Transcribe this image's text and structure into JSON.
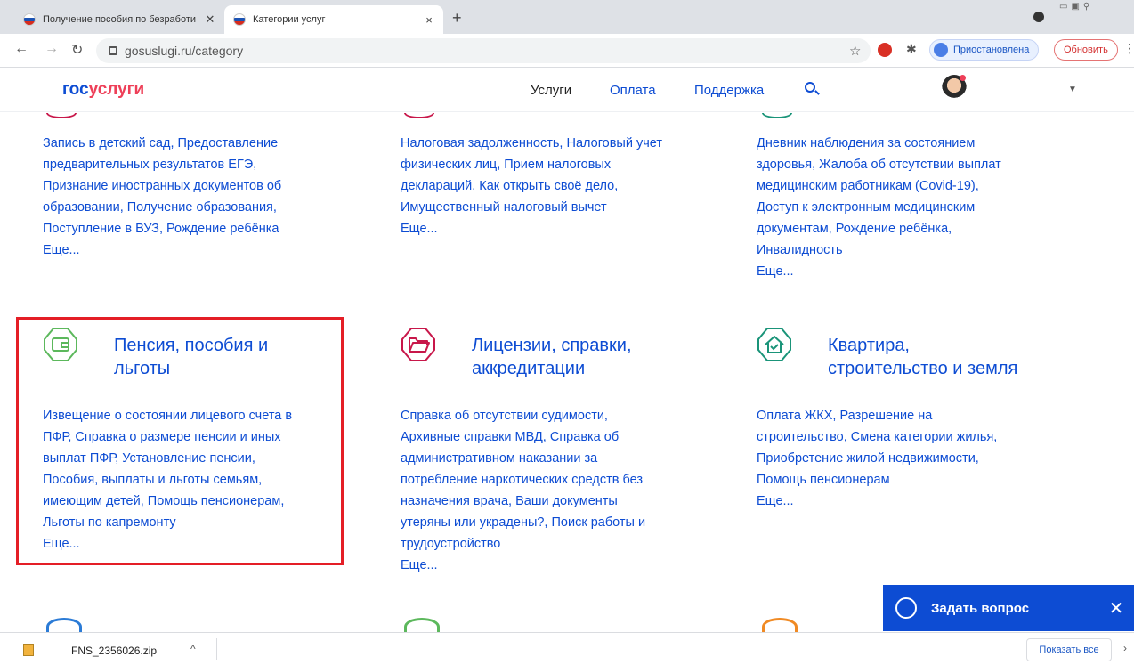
{
  "browser": {
    "tabs": [
      {
        "title": "Получение пособия по безработи",
        "close": "✕"
      },
      {
        "title": "Категории услуг",
        "close": "×"
      }
    ],
    "new_tab": "+",
    "url": "gosuslugi.ru/category",
    "profile_label": "Приостановлена",
    "update_label": "Обновить"
  },
  "site": {
    "logo_part1": "гос",
    "logo_part2": "услуги",
    "nav": [
      "Услуги",
      "Оплата",
      "Поддержка"
    ],
    "accent": "#0d4cd3",
    "logo_red": "#ee3f58"
  },
  "categories_top": [
    {
      "lines": [
        "Запись в детский сад, Предоставление",
        "предварительных результатов ЕГЭ,",
        "Признание иностранных документов об",
        "образовании, Получение образования,",
        "Поступление в ВУЗ, Рождение ребёнка"
      ],
      "more": "Еще..."
    },
    {
      "lines": [
        "Налоговая задолженность, Налоговый учет",
        "физических лиц, Прием налоговых",
        "деклараций, Как открыть своё дело,",
        "Имущественный налоговый вычет"
      ],
      "more": "Еще..."
    },
    {
      "lines": [
        "Дневник наблюдения за состоянием",
        "здоровья, Жалоба об отсутствии выплат",
        "медицинским работникам (Covid-19),",
        "Доступ к электронным медицинским",
        "документам, Рождение ребёнка,",
        "Инвалидность"
      ],
      "more": "Еще..."
    }
  ],
  "categories_mid": [
    {
      "title_lines": [
        "Пенсия, пособия и",
        "льготы"
      ],
      "icon": "wallet-icon",
      "color": "#5cb85c",
      "lines": [
        "Извещение о состоянии лицевого счета в",
        "ПФР, Справка о размере пенсии и иных",
        "выплат ПФР, Установление пенсии,",
        "Пособия, выплаты и льготы семьям,",
        "имеющим детей, Помощь пенсионерам,",
        "Льготы по капремонту"
      ],
      "more": "Еще..."
    },
    {
      "title_lines": [
        "Лицензии, справки,",
        "аккредитации"
      ],
      "icon": "folder-icon",
      "color": "#c8174a",
      "lines": [
        "Справка об отсутствии судимости,",
        "Архивные справки МВД, Справка об",
        "административном наказании за",
        "потребление наркотических средств без",
        "назначения врача, Ваши документы",
        "утеряны или украдены?, Поиск работы и",
        "трудоустройство"
      ],
      "more": "Еще..."
    },
    {
      "title_lines": [
        "Квартира,",
        "строительство и земля"
      ],
      "icon": "house-icon",
      "color": "#1a9479",
      "lines": [
        "Оплата ЖКХ, Разрешение на",
        "строительство, Смена категории жилья,",
        "Приобретение жилой недвижимости,",
        "Помощь пенсионерам"
      ],
      "more": "Еще..."
    }
  ],
  "chat": {
    "label": "Задать вопрос",
    "close": "✕"
  },
  "downloads": {
    "file": "FNS_2356026.zip",
    "show_all": "Показать все"
  }
}
